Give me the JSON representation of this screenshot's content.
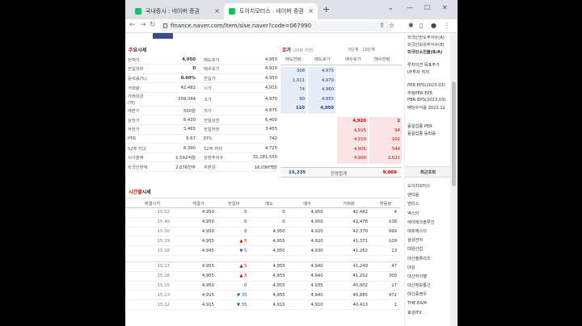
{
  "browser": {
    "tabs": [
      {
        "title": "국내증시 : 네이버 증권"
      },
      {
        "title": "도이치모터스 : 네이버 증권"
      }
    ],
    "url": "finance.naver.com/item/sise.naver?code=067990"
  },
  "quote": {
    "title_red": "주",
    "title_rest": "요시세",
    "rows": [
      {
        "l": "현재가",
        "v": "4,950",
        "l2": "매도호가",
        "v2": "4,950"
      },
      {
        "l": "전일대비",
        "v": "0",
        "l2": "매수호가",
        "v2": "4,920"
      },
      {
        "l": "등락률(%)",
        "v": "0.00%",
        "l2": "전일가",
        "v2": "4,950"
      },
      {
        "l": "거래량",
        "v": "42,482",
        "l2": "시가",
        "v2": "4,915"
      },
      {
        "l": "거래대금(백)",
        "v": "209,344",
        "l2": "고가",
        "v2": "4,970"
      },
      {
        "l": "액면가",
        "v": "500원",
        "l2": "저가",
        "v2": "4,875"
      },
      {
        "l": "상한가",
        "v": "6,430",
        "l2": "전일상한",
        "v2": "6,400"
      },
      {
        "l": "하한가",
        "v": "3,465",
        "l2": "전일하한",
        "v2": "3,455"
      },
      {
        "l": "PER",
        "v": "6.67",
        "l2": "EPS",
        "v2": "742"
      },
      {
        "l": "52주 최고",
        "v": "8,390",
        "l2": "52주 최저",
        "v2": "4,725"
      },
      {
        "l": "시가총액",
        "v": "1,592억원",
        "l2": "상장주식수",
        "v2": "32,181,550"
      },
      {
        "l": "외국인현재",
        "v": "2,076천주",
        "l2": "자본금",
        "v2": "16,090백만"
      }
    ]
  },
  "orderbook": {
    "title_red": "호",
    "title_rest": "가",
    "sub": "(20분 지연)",
    "links": "5단계 · 10단계",
    "headers": [
      "매도잔량",
      "매도호가",
      "매수호가",
      "매수잔량"
    ],
    "asks": [
      {
        "q": "308",
        "p": "4,975"
      },
      {
        "q": "1,011",
        "p": "4,970"
      },
      {
        "q": "74",
        "p": "4,960"
      },
      {
        "q": "90",
        "p": "4,955"
      },
      {
        "q": "110",
        "p": "4,950"
      }
    ],
    "bids": [
      {
        "p": "4,920",
        "q": "2"
      },
      {
        "p": "4,915",
        "q": "94"
      },
      {
        "p": "4,910",
        "q": "102"
      },
      {
        "p": "4,905",
        "q": "544"
      },
      {
        "p": "4,900",
        "q": "2,621"
      }
    ],
    "total_ask": "15,235",
    "total_label": "잔량합계",
    "total_bid": "9,068"
  },
  "ticks": {
    "title_red": "시간별",
    "title_rest": "시세",
    "headers": [
      "체결시각",
      "체결가",
      "전일비",
      "매도",
      "매수",
      "거래량",
      "변동량"
    ],
    "rows": [
      {
        "t": "15:52",
        "p": "4,950",
        "c": "0",
        "d": "",
        "s": "0",
        "b": "4,950",
        "v": "42,482",
        "dv": "4"
      },
      {
        "t": "15:40",
        "p": "4,950",
        "c": "0",
        "d": "",
        "s": "0",
        "b": "4,950",
        "v": "42,478",
        "dv": "108"
      },
      {
        "t": "15:30",
        "p": "4,950",
        "c": "0",
        "d": "",
        "s": "4,950",
        "b": "4,920",
        "v": "42,370",
        "dv": "999"
      },
      {
        "t": "15:19",
        "p": "4,955",
        "c": "5",
        "d": "up",
        "s": "4,955",
        "b": "4,920",
        "v": "41,371",
        "dv": "109"
      },
      {
        "t": "15:18",
        "p": "4,945",
        "c": "5",
        "d": "dn",
        "s": "4,950",
        "b": "4,930",
        "v": "41,262",
        "dv": "13"
      },
      {
        "t": "15:17",
        "p": "4,955",
        "c": "5",
        "d": "up",
        "s": "4,955",
        "b": "4,940",
        "v": "41,249",
        "dv": "47"
      },
      {
        "t": "15:16",
        "p": "4,955",
        "c": "5",
        "d": "up",
        "s": "4,955",
        "b": "4,940",
        "v": "41,202",
        "dv": "300"
      },
      {
        "t": "15:15",
        "p": "4,950",
        "c": "0",
        "d": "",
        "s": "4,955",
        "b": "4,935",
        "v": "40,902",
        "dv": "17"
      },
      {
        "t": "15:13",
        "p": "4,915",
        "c": "35",
        "d": "dn",
        "s": "4,955",
        "b": "4,940",
        "v": "40,885",
        "dv": "472"
      },
      {
        "t": "15:12",
        "p": "4,915",
        "c": "35",
        "d": "dn",
        "s": "4,915",
        "b": "4,910",
        "v": "40,413",
        "dv": "1"
      }
    ]
  },
  "side": {
    "top": [
      "외국인한도주식수(A)",
      "외국인보유주식수(B)",
      "외국인소진율(B/A)"
    ],
    "mid": [
      "투자의견  목표주가",
      "I/F투자 최저"
    ],
    "per": [
      "PER  EPS(2023.03)",
      "추정PER  EPS",
      "PBR  BPS(2023.03)",
      "배당수익률  2022.12"
    ],
    "ind": [
      "동일업종 PER",
      "동일업종 등락률"
    ],
    "recent_label": "최근조회",
    "recent": [
      "도이치모터스",
      "엔티움",
      "엔티스",
      "엑스터",
      "에이테크솔루션",
      "에프에스티",
      "삼성전자",
      "대원산업",
      "대신밸류리츠",
      "대성",
      "대신하이벨",
      "대신정보통신",
      "대신증권우",
      "THE E&M",
      "효성ITX"
    ]
  }
}
